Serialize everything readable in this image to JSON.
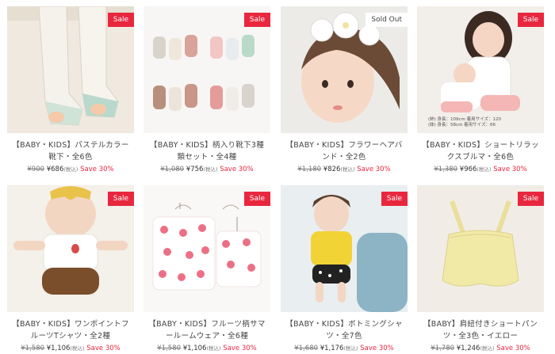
{
  "products": [
    {
      "badge": "Sale",
      "title": "【BABY・KIDS】パステルカラー靴下・全6色",
      "old_price": "¥900",
      "price": "¥686",
      "tax": "(税込)",
      "save": "Save 30%"
    },
    {
      "badge": "Sale",
      "title": "【BABY・KIDS】柄入り靴下3種類セット・全4種",
      "old_price": "¥1,080",
      "price": "¥756",
      "tax": "(税込)",
      "save": "Save 30%"
    },
    {
      "badge": "Sold Out",
      "title": "【BABY・KIDS】フラワーヘアバンド・全2色",
      "old_price": "¥1,180",
      "price": "¥826",
      "tax": "(税込)",
      "save": "Save 30%"
    },
    {
      "badge": "Sale",
      "title": "【BABY・KIDS】ショートリラックスブルマ・全6色",
      "old_price": "¥1,380",
      "price": "¥966",
      "tax": "(税込)",
      "save": "Save 30%",
      "image_caption": [
        "(姉) 身長：109cm 着用サイズ：120",
        "(妹) 身長：58cm 着用サイズ：66"
      ]
    },
    {
      "badge": "Sale",
      "title": "【BABY・KIDS】ワンポイントフルーツTシャツ・全2種",
      "old_price": "¥1,580",
      "price": "¥1,106",
      "tax": "(税込)",
      "save": "Save 30%"
    },
    {
      "badge": "Sale",
      "title": "【BABY・KIDS】フルーツ柄サマールームウェア・全6種",
      "old_price": "¥1,580",
      "price": "¥1,106",
      "tax": "(税込)",
      "save": "Save 30%"
    },
    {
      "badge": "Sale",
      "title": "【BABY・KIDS】ボトミングシャツ・全7色",
      "old_price": "¥1,680",
      "price": "¥1,176",
      "tax": "(税込)",
      "save": "Save 30%"
    },
    {
      "badge": "Sale",
      "title": "【BABY】肩紐付きショートパンツ・全3色・イエロー",
      "old_price": "¥1,780",
      "price": "¥1,246",
      "tax": "(税込)",
      "save": "Save 30%"
    }
  ]
}
